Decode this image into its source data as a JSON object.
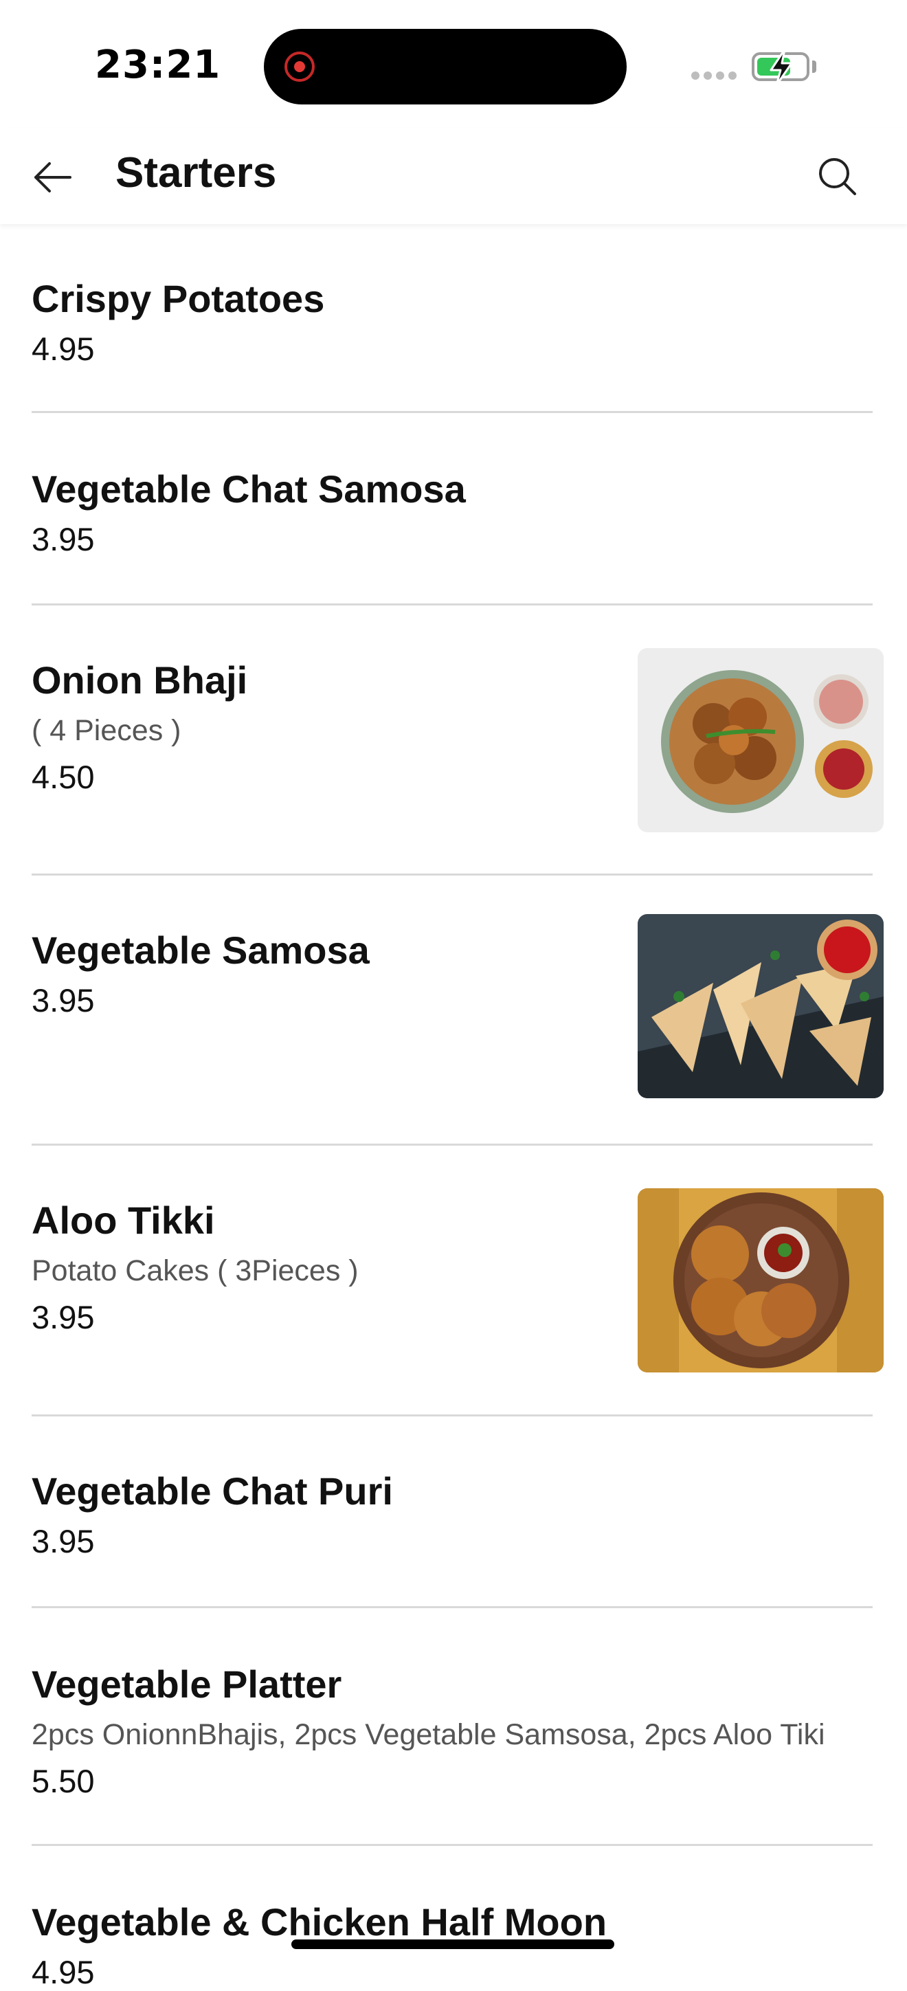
{
  "status_bar": {
    "time": "23:21",
    "battery_level": 0.7,
    "battery_charging": true,
    "recording_indicator": true
  },
  "header": {
    "back_icon": "arrow-left-icon",
    "title": "Starters",
    "search_icon": "search-icon"
  },
  "menu": {
    "items": [
      {
        "name": "Crispy Potatoes",
        "description": "",
        "price": "4.95",
        "has_image": false
      },
      {
        "name": "Vegetable Chat Samosa",
        "description": "",
        "price": "3.95",
        "has_image": false
      },
      {
        "name": "Onion Bhaji",
        "description": "( 4 Pieces )",
        "price": "4.50",
        "has_image": true,
        "image": "onion-bhaji-photo"
      },
      {
        "name": "Vegetable Samosa",
        "description": "",
        "price": "3.95",
        "has_image": true,
        "image": "vegetable-samosa-photo"
      },
      {
        "name": "Aloo Tikki",
        "description": "Potato Cakes ( 3Pieces )",
        "price": "3.95",
        "has_image": true,
        "image": "aloo-tikki-photo"
      },
      {
        "name": "Vegetable Chat Puri",
        "description": "",
        "price": "3.95",
        "has_image": false
      },
      {
        "name": "Vegetable Platter",
        "description": "2pcs OnionnBhajis, 2pcs Vegetable Samsosa, 2pcs Aloo Tiki",
        "price": "5.50",
        "has_image": false
      },
      {
        "name": "Vegetable & Chicken Half Moon",
        "description": "",
        "price": "4.95",
        "has_image": false
      }
    ]
  },
  "colors": {
    "accent_text": "#111111",
    "secondary_text": "#555555",
    "divider": "#d9d9d9",
    "battery_green": "#34c759",
    "record_red": "#e53935"
  }
}
